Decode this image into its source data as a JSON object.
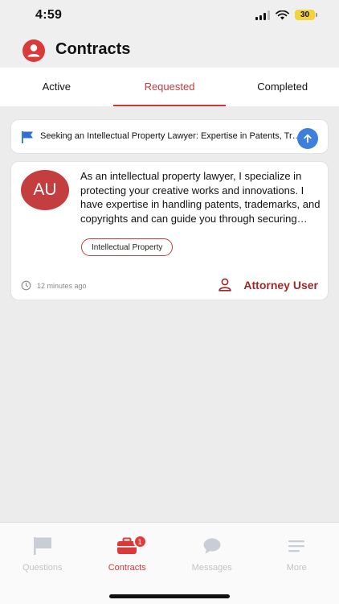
{
  "status_bar": {
    "time": "4:59",
    "battery": "30"
  },
  "header": {
    "title": "Contracts",
    "avatar_color": "#d93a3a"
  },
  "tabs": [
    {
      "label": "Active",
      "active": false
    },
    {
      "label": "Requested",
      "active": true
    },
    {
      "label": "Completed",
      "active": false
    }
  ],
  "request": {
    "text": "Seeking an Intellectual Property Lawyer: Expertise in Patents, Trademarks, and Copyrights",
    "icon": "flag-icon",
    "action_icon": "arrow-up-icon"
  },
  "card": {
    "initials": "AU",
    "description": "As an intellectual property lawyer, I specialize in protecting your creative works and innovations. I have expertise in handling patents, trademarks, and copyrights and can guide you through securing intellectual property rights.",
    "tag": "Intellectual Property",
    "time_ago": "12 minutes ago",
    "attorney": "Attorney User"
  },
  "tab_bar": [
    {
      "label": "Questions",
      "icon": "flag-icon",
      "active": false
    },
    {
      "label": "Contracts",
      "icon": "briefcase-icon",
      "active": true,
      "badge": "1"
    },
    {
      "label": "Messages",
      "icon": "chat-icon",
      "active": false
    },
    {
      "label": "More",
      "icon": "menu-icon",
      "active": false
    }
  ],
  "colors": {
    "accent": "#c8393b",
    "blue": "#3f7fdc",
    "attorney": "#9a2a2a"
  }
}
